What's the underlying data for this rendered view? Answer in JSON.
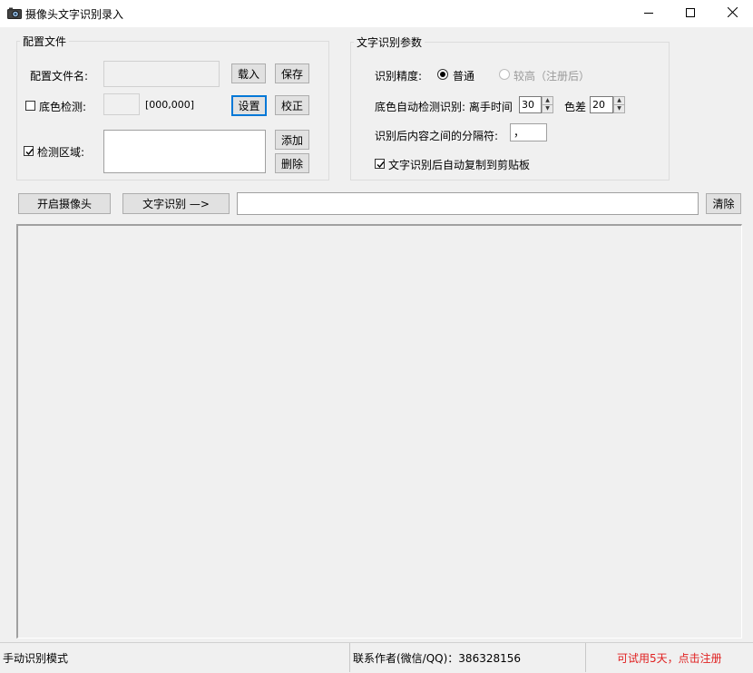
{
  "window": {
    "title": "摄像头文字识别录入",
    "minimize_icon": "minimize-icon",
    "maximize_icon": "maximize-icon",
    "close_icon": "close-icon"
  },
  "config": {
    "group_label": "配置文件",
    "filename_label": "配置文件名:",
    "filename_value": "",
    "load_button": "载入",
    "save_button": "保存",
    "bgcolor_label": "底色检测:",
    "bgcolor_checked": false,
    "bgcolor_value": "[000,000]",
    "setup_button": "设置",
    "calibrate_button": "校正",
    "region_label": "检测区域:",
    "region_checked": true,
    "add_button": "添加",
    "delete_button": "删除"
  },
  "ocr": {
    "group_label": "文字识别参数",
    "precision_label": "识别精度:",
    "option_normal": "普通",
    "option_high": "较高（注册后）",
    "selected": "普通",
    "auto_detect_label": "底色自动检测识别: 离手时间",
    "leave_time": "30",
    "color_diff_label": "色差",
    "color_diff": "20",
    "separator_label": "识别后内容之间的分隔符:",
    "separator_value": "，",
    "auto_copy_label": "文字识别后自动复制到剪贴板",
    "auto_copy_checked": true
  },
  "toolbar": {
    "camera_button": "开启摄像头",
    "recognize_button": "文字识别 —>",
    "result_value": "",
    "clear_button": "清除"
  },
  "status": {
    "mode": "手动识别模式",
    "contact": "联系作者(微信/QQ)：386328156",
    "trial": "可试用5天，点击注册",
    "trial_color": "#e02020"
  }
}
